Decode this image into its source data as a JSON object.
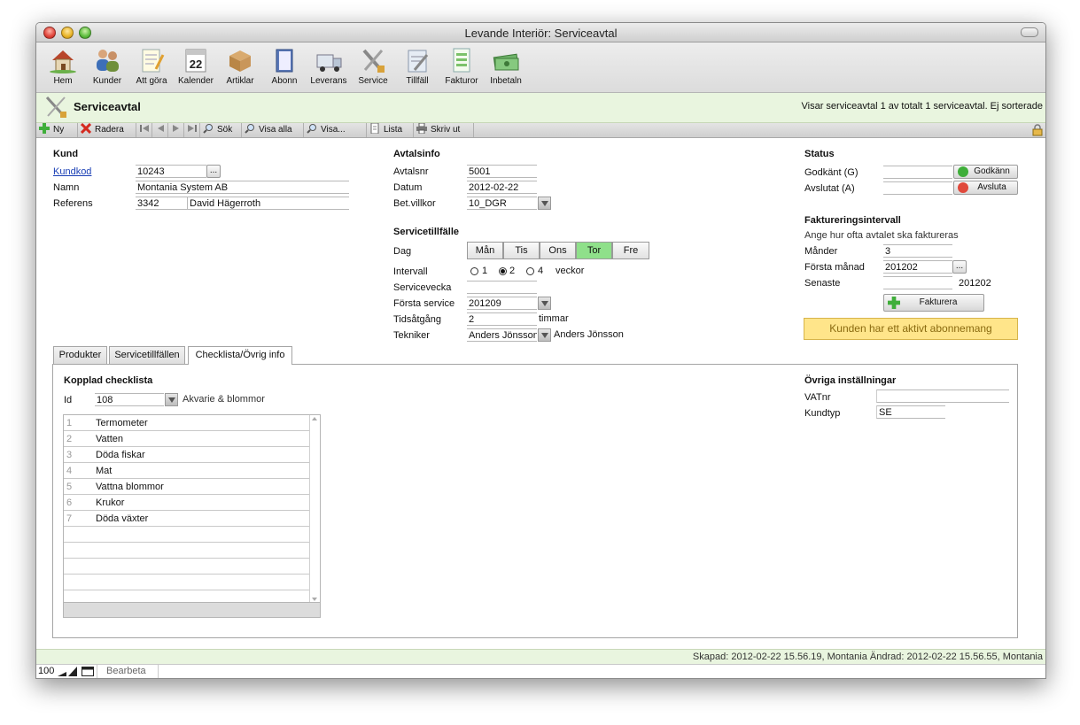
{
  "window": {
    "title": "Levande Interiör: Serviceavtal"
  },
  "toolbar": {
    "items": [
      {
        "label": "Hem",
        "icon": "house-icon"
      },
      {
        "label": "Kunder",
        "icon": "people-icon"
      },
      {
        "label": "Att göra",
        "icon": "notepad-icon"
      },
      {
        "label": "Kalender",
        "icon": "calendar-icon",
        "day": "22"
      },
      {
        "label": "Artiklar",
        "icon": "box-icon"
      },
      {
        "label": "Abonn",
        "icon": "book-icon"
      },
      {
        "label": "Leverans",
        "icon": "truck-icon"
      },
      {
        "label": "Service",
        "icon": "tools-icon"
      },
      {
        "label": "Tillfäll",
        "icon": "clipboard-icon"
      },
      {
        "label": "Fakturor",
        "icon": "invoice-icon"
      },
      {
        "label": "Inbetaln",
        "icon": "money-icon"
      }
    ]
  },
  "header": {
    "title": "Serviceavtal",
    "status": "Visar serviceavtal 1 av totalt 1 serviceavtal. Ej sorterade"
  },
  "navbar": {
    "new": "Ny",
    "delete": "Radera",
    "search": "Sök",
    "show_all": "Visa alla",
    "show": "Visa...",
    "list": "Lista",
    "print": "Skriv ut"
  },
  "kund": {
    "section": "Kund",
    "kundkod_label": "Kundkod",
    "kundkod": "10243",
    "namn_label": "Namn",
    "namn": "Montania System AB",
    "referens_label": "Referens",
    "referens_id": "3342",
    "referens_name": "David Hägerroth"
  },
  "avtalsinfo": {
    "section": "Avtalsinfo",
    "avtalsnr_label": "Avtalsnr",
    "avtalsnr": "5001",
    "datum_label": "Datum",
    "datum": "2012-02-22",
    "betvillkor_label": "Bet.villkor",
    "betvillkor": "10_DGR"
  },
  "servicetillfalle": {
    "section": "Servicetillfälle",
    "dag_label": "Dag",
    "days": [
      "Mån",
      "Tis",
      "Ons",
      "Tor",
      "Fre"
    ],
    "selected_day": "Tor",
    "intervall_label": "Intervall",
    "interval_options": [
      "1",
      "2",
      "4"
    ],
    "interval_selected": "2",
    "interval_unit": "veckor",
    "servicevecka_label": "Servicevecka",
    "servicevecka": "",
    "forsta_service_label": "Första service",
    "forsta_service": "201209",
    "tidsatgang_label": "Tidsåtgång",
    "tidsatgang": "2",
    "tidsatgang_unit": "timmar",
    "tekniker_label": "Tekniker",
    "tekniker": "Anders Jönsson",
    "tekniker_display": "Anders Jönsson"
  },
  "status": {
    "section": "Status",
    "godkant_label": "Godkänt (G)",
    "godkant": "",
    "godkann_button": "Godkänn",
    "avslutat_label": "Avslutat (A)",
    "avslutat": "",
    "avsluta_button": "Avsluta"
  },
  "fakturering": {
    "section": "Faktureringsintervall",
    "hint": "Ange hur ofta avtalet ska faktureras",
    "manader_label": "Månder",
    "manader": "3",
    "forsta_manad_label": "Första månad",
    "forsta_manad": "201202",
    "senaste_label": "Senaste",
    "senaste": "",
    "senaste_value": "201202",
    "fakturera_button": "Fakturera",
    "banner": "Kunden har ett aktivt abonnemang"
  },
  "tabs": [
    {
      "label": "Produkter"
    },
    {
      "label": "Servicetillfällen"
    },
    {
      "label": "Checklista/Övrig info"
    }
  ],
  "checklist": {
    "section": "Kopplad checklista",
    "id_label": "Id",
    "id": "108",
    "name": "Akvarie & blommor",
    "items": [
      {
        "n": "1",
        "text": "Termometer"
      },
      {
        "n": "2",
        "text": "Vatten"
      },
      {
        "n": "3",
        "text": "Döda fiskar"
      },
      {
        "n": "4",
        "text": "Mat"
      },
      {
        "n": "5",
        "text": "Vattna blommor"
      },
      {
        "n": "6",
        "text": "Krukor"
      },
      {
        "n": "7",
        "text": "Döda växter"
      }
    ]
  },
  "ovriga": {
    "section": "Övriga inställningar",
    "vatnr_label": "VATnr",
    "vatnr": "",
    "kundtyp_label": "Kundtyp",
    "kundtyp": "SE"
  },
  "footer": {
    "text": "Skapad: 2012-02-22 15.56.19, Montania Ändrad: 2012-02-22 15.56.55, Montania"
  },
  "statusbar": {
    "zoom": "100",
    "mode": "Bearbeta"
  }
}
